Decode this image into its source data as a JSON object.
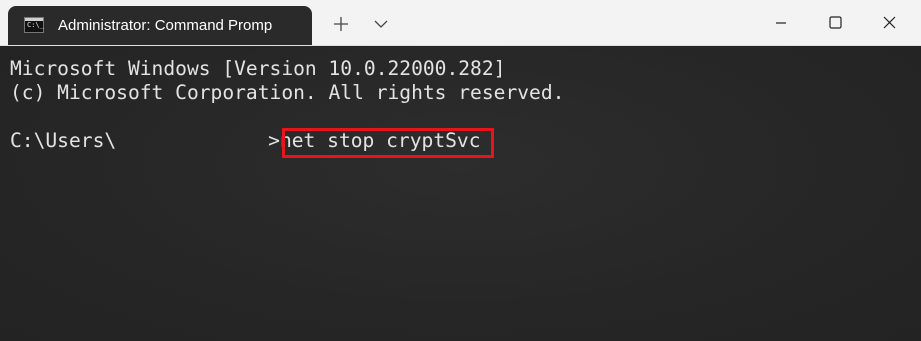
{
  "tab": {
    "title": "Administrator: Command Promp",
    "icon": "command-prompt-icon"
  },
  "titlebar": {
    "new_tab_icon": "plus-icon",
    "dropdown_icon": "chevron-down-icon",
    "minimize_icon": "minimize-icon",
    "maximize_icon": "maximize-icon",
    "close_icon": "close-icon"
  },
  "terminal": {
    "line1": "Microsoft Windows [Version 10.0.22000.282]",
    "line2": "(c) Microsoft Corporation. All rights reserved.",
    "prompt_path": "C:\\Users\\",
    "prompt_char": ">",
    "command": "net stop cryptSvc"
  },
  "colors": {
    "titlebar_bg": "#f3f3f3",
    "tab_bg": "#2a2a2a",
    "terminal_bg": "#262626",
    "terminal_text": "#e3e3e3",
    "highlight_border": "#e8141c"
  }
}
